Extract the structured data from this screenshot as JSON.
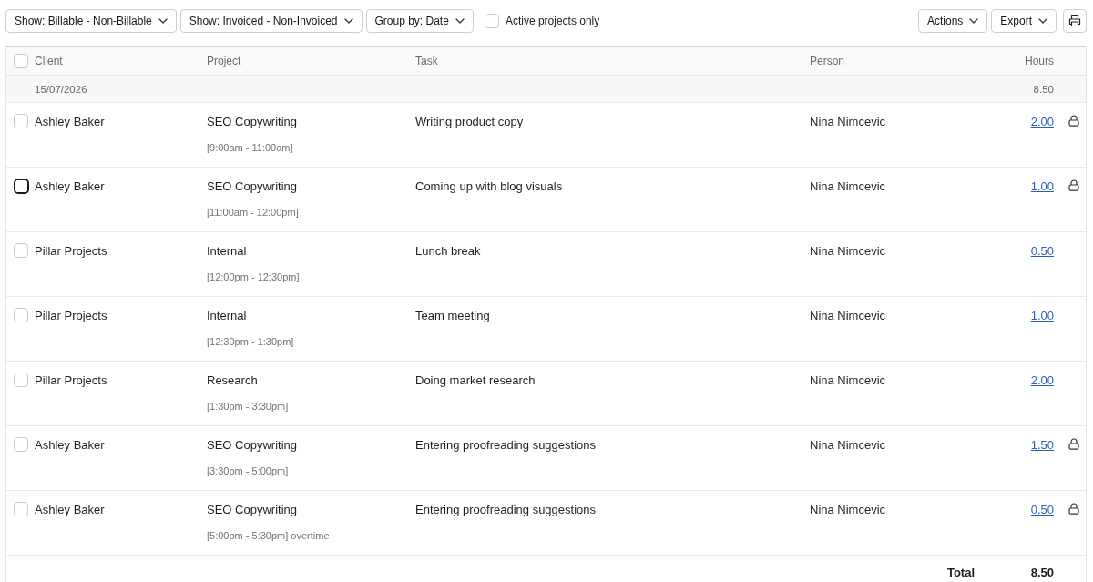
{
  "filters": [
    "Show: Billable - Non-Billable",
    "Show: Invoiced - Non-Invoiced",
    "Group by: Date"
  ],
  "active_projects_only": {
    "label": "Active projects only",
    "checked": false
  },
  "menus": [
    "Actions",
    "Export"
  ],
  "table": {
    "select_all": {
      "checked": false
    },
    "columns": [
      "Client",
      "Project",
      "Task",
      "Person",
      "Hours"
    ],
    "groups": [
      {
        "date": "15/07/2026",
        "hours": "8.50",
        "rows": [
          {
            "client": "Ashley Baker",
            "project": "SEO Copywriting",
            "time": "[9:00am - 11:00am]",
            "task": "Writing product copy",
            "person": "Nina Nimcevic",
            "hours": "2.00",
            "locked": true,
            "checked": false,
            "focused": false
          },
          {
            "client": "Ashley Baker",
            "project": "SEO Copywriting",
            "time": "[11:00am - 12:00pm]",
            "task": "Coming up with blog visuals",
            "person": "Nina Nimcevic",
            "hours": "1.00",
            "locked": true,
            "checked": false,
            "focused": true
          },
          {
            "client": "Pillar Projects",
            "project": "Internal",
            "time": "[12:00pm - 12:30pm]",
            "task": "Lunch break",
            "person": "Nina Nimcevic",
            "hours": "0.50",
            "locked": false,
            "checked": false,
            "focused": false
          },
          {
            "client": "Pillar Projects",
            "project": "Internal",
            "time": "[12:30pm - 1:30pm]",
            "task": "Team meeting",
            "person": "Nina Nimcevic",
            "hours": "1.00",
            "locked": false,
            "checked": false,
            "focused": false
          },
          {
            "client": "Pillar Projects",
            "project": "Research",
            "time": "[1:30pm - 3:30pm]",
            "task": "Doing market research",
            "person": "Nina Nimcevic",
            "hours": "2.00",
            "locked": false,
            "checked": false,
            "focused": false
          },
          {
            "client": "Ashley Baker",
            "project": "SEO Copywriting",
            "time": "[3:30pm - 5:00pm]",
            "task": "Entering proofreading suggestions",
            "person": "Nina Nimcevic",
            "hours": "1.50",
            "locked": true,
            "checked": false,
            "focused": false
          },
          {
            "client": "Ashley Baker",
            "project": "SEO Copywriting",
            "time": "[5:00pm - 5:30pm] overtime",
            "task": "Entering proofreading suggestions",
            "person": "Nina Nimcevic",
            "hours": "0.50",
            "locked": true,
            "checked": false,
            "focused": false
          }
        ]
      }
    ],
    "total": {
      "label": "Total",
      "hours": "8.50"
    }
  }
}
